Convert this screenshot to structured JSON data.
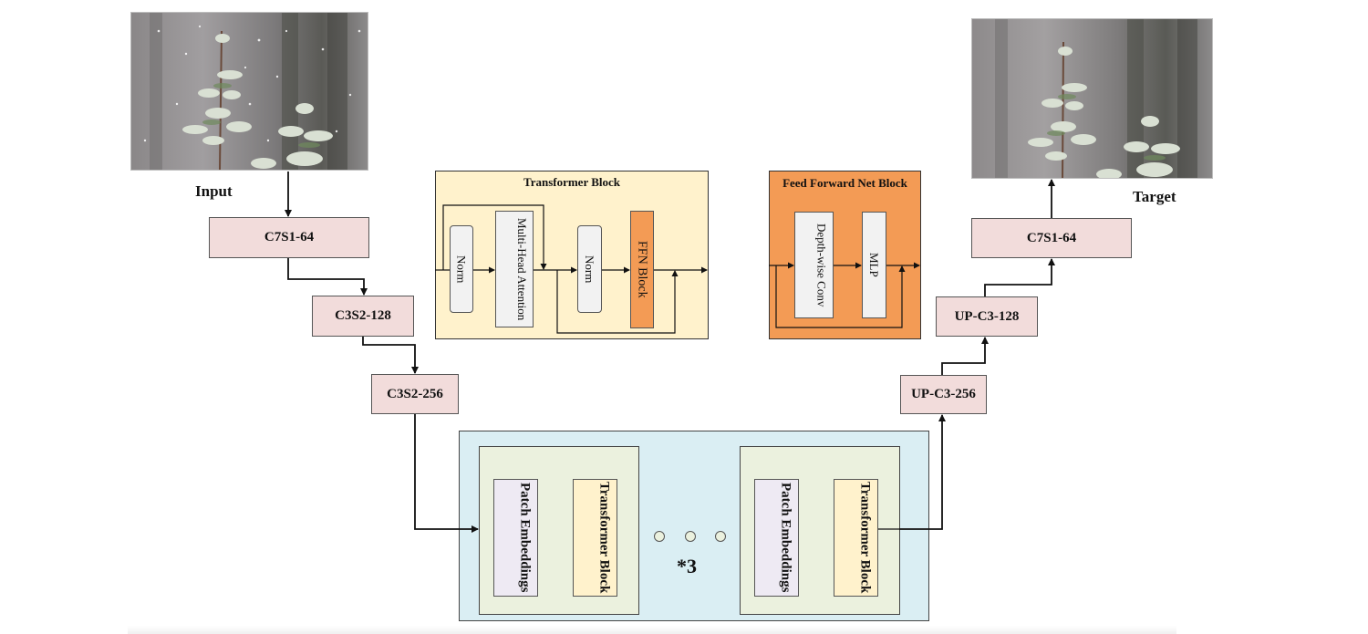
{
  "images": {
    "input": {
      "label": "Input",
      "description": "snowy pine branches photo (rainy/snowy input)"
    },
    "target": {
      "label": "Target",
      "description": "snowy pine branches photo (clean target)"
    }
  },
  "encoder": [
    {
      "label": "C7S1-64"
    },
    {
      "label": "C3S2-128"
    },
    {
      "label": "C3S2-256"
    }
  ],
  "decoder": [
    {
      "label": "UP-C3-256"
    },
    {
      "label": "UP-C3-128"
    },
    {
      "label": "C7S1-64"
    }
  ],
  "transformer_block_panel": {
    "title": "Transformer Block",
    "norm1": "Norm",
    "attention": "Multi-Head Attention",
    "norm2": "Norm",
    "ffn": "FFN Block"
  },
  "ffn_panel": {
    "title": "Feed Forward Net Block",
    "conv": "Depth-wise Conv",
    "mlp": "MLP"
  },
  "bottleneck": {
    "stage_left": {
      "patch": "Patch Embeddings",
      "transformer": "Transformer Block"
    },
    "stage_right": {
      "patch": "Patch Embeddings",
      "transformer": "Transformer Block"
    },
    "repeat_label": "*3"
  },
  "colors": {
    "conv_fill": "#f2dcdb",
    "transformer_panel_fill": "#fff2cc",
    "ffn_fill": "#f39b55",
    "bottleneck_fill": "#daeef3",
    "stage_fill": "#ebf1de",
    "patch_fill": "#eeeaf3",
    "norm_fill": "#f2f2f2"
  }
}
